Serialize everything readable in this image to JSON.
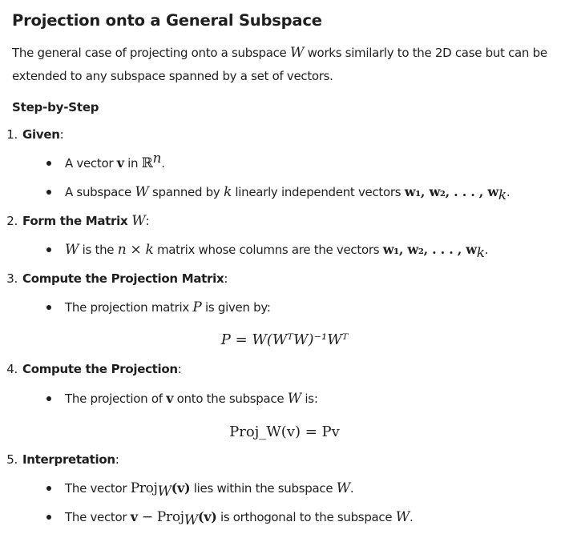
{
  "title": "Projection onto a General Subspace",
  "intro": {
    "pre": "The general case of projecting onto a subspace ",
    "var": "W",
    "post": " works similarly to the 2D case but can be extended to any subspace spanned by a set of vectors."
  },
  "section": "Step-by-Step",
  "steps": [
    {
      "num": "1.",
      "label": "Given",
      "suffix": ":",
      "bullets": [
        {
          "t1": "A vector ",
          "v": "v",
          "t2": " in ",
          "R": "ℝ",
          "n": "n",
          "end": "."
        },
        {
          "t1": "A subspace ",
          "W": "W",
          "t2": " spanned by ",
          "k": "k",
          "t3": " linearly independent vectors ",
          "vecs": "w₁, w₂, . . . , w",
          "vk": "k",
          "end": "."
        }
      ]
    },
    {
      "num": "2.",
      "label": "Form the Matrix ",
      "labelvar": "W",
      "suffix": ":",
      "bullets": [
        {
          "W": "W",
          "t1": " is the ",
          "dims": "n × k",
          "t2": " matrix whose columns are the vectors ",
          "vecs": "w₁, w₂, . . . , w",
          "vk": "k",
          "end": "."
        }
      ]
    },
    {
      "num": "3.",
      "label": "Compute the Projection Matrix",
      "suffix": ":",
      "bullets": [
        {
          "t1": "The projection matrix ",
          "P": "P",
          "t2": " is given by:"
        }
      ],
      "formula": "P = W(WᵀW)⁻¹Wᵀ"
    },
    {
      "num": "4.",
      "label": "Compute the Projection",
      "suffix": ":",
      "bullets": [
        {
          "t1": "The projection of ",
          "v": "v",
          "t2": " onto the subspace ",
          "W": "W",
          "t3": " is:"
        }
      ],
      "formula": "Proj_W(v) = Pv"
    },
    {
      "num": "5.",
      "label": "Interpretation",
      "suffix": ":",
      "bullets": [
        {
          "t1": "The vector ",
          "proj": "Proj",
          "sub": "W",
          "arg": "(v)",
          "t2": " lies within the subspace ",
          "W": "W",
          "end": "."
        },
        {
          "t1": "The vector ",
          "v": "v",
          "minus": " − ",
          "proj": "Proj",
          "sub": "W",
          "arg": "(v)",
          "t2": " is orthogonal to the subspace ",
          "W": "W",
          "end": "."
        }
      ]
    }
  ]
}
